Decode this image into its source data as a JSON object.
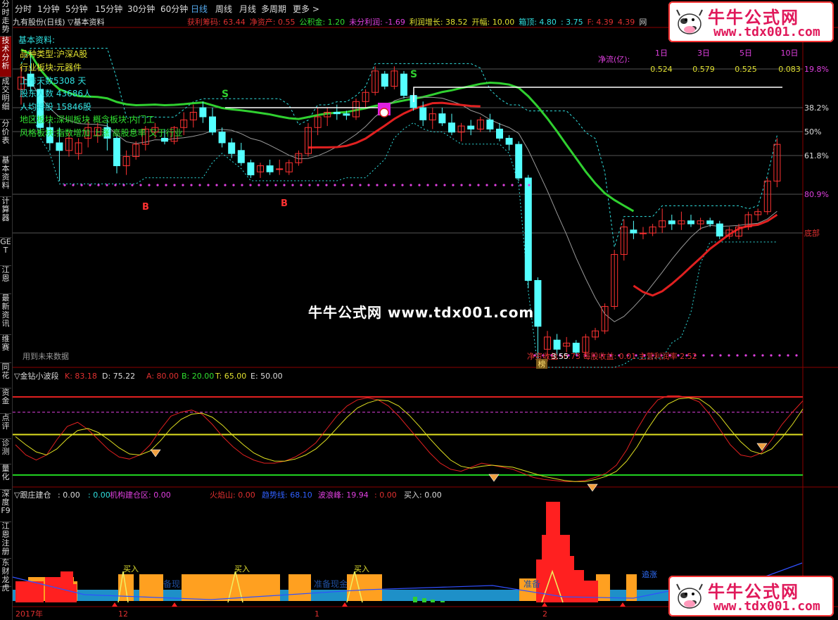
{
  "sidebar": {
    "items": [
      {
        "label": "分时走势",
        "active": false
      },
      {
        "label": "技术分析",
        "active": true
      },
      {
        "label": "成交明细",
        "active": false
      },
      {
        "label": "分价表",
        "active": false
      },
      {
        "label": "基本资料",
        "active": false
      },
      {
        "label": "计算器",
        "active": false
      },
      {
        "label": "GET",
        "active": false
      },
      {
        "label": "江恩",
        "active": false
      },
      {
        "label": "最新资讯",
        "active": false
      },
      {
        "label": "维赛",
        "active": false
      },
      {
        "label": "同花",
        "active": false
      },
      {
        "label": "资金",
        "active": false
      },
      {
        "label": "点评",
        "active": false
      },
      {
        "label": "诊测",
        "active": false
      },
      {
        "label": "量化",
        "active": false
      },
      {
        "label": "深度F9",
        "active": false
      },
      {
        "label": "江恩注册",
        "active": false
      },
      {
        "label": "东财龙虎",
        "active": false
      }
    ]
  },
  "toolbar": {
    "periods": [
      "分时",
      "1分钟",
      "5分钟",
      "15分钟",
      "30分钟",
      "60分钟",
      "日线",
      "周线",
      "月线",
      "多周期",
      "更多 >"
    ],
    "active": "日线"
  },
  "infobar": {
    "title": "九有股份(日线) ▽基本资料",
    "items": [
      {
        "text": "获利筹码: 63.44",
        "color": "#e03030"
      },
      {
        "text": "净资产: 0.55",
        "color": "#e03030"
      },
      {
        "text": "公积金: 1.20",
        "color": "#30e030"
      },
      {
        "text": "未分利润: -1.69",
        "color": "#e040e0"
      },
      {
        "text": "利润增长: 38.52",
        "color": "#e0e030"
      },
      {
        "text": "开幅: 10.00",
        "color": "#e0e030"
      },
      {
        "text": "箱顶: 4.80",
        "color": "#30e0e0"
      },
      {
        "text": ": 3.75",
        "color": "#30e0e0"
      },
      {
        "text": "F: 4.39",
        "color": "#e03030"
      },
      {
        "text": "4.39",
        "color": "#e03030"
      },
      {
        "text": "网",
        "color": "#ccc"
      }
    ]
  },
  "basic_info": [
    {
      "text": "基本资料:",
      "color": "#30e0e0"
    },
    {
      "text": "品种类型:沪深A股",
      "color": "#e0e030"
    },
    {
      "text": "行业板块:元器件",
      "color": "#e0e030"
    },
    {
      "text": "上市天数5308 天",
      "color": "#30e0e0"
    },
    {
      "text": "股东人数 43686人",
      "color": "#30e0e0"
    },
    {
      "text": "人均持股 15846股",
      "color": "#30e0e0"
    },
    {
      "text": "地区板块:深圳板块 概念板块:内门工",
      "color": "#30e030"
    },
    {
      "text": "风格板块:指数增加 上涨 高股息率 又于行业",
      "color": "#30e030"
    }
  ],
  "netflow": {
    "label": "净流(亿):",
    "headers": [
      "1日",
      "3日",
      "5日",
      "10日"
    ],
    "values": [
      "0.524",
      "0.579",
      "0.525",
      "0.083"
    ]
  },
  "fib_labels": [
    {
      "text": "19.8%",
      "color": "#e040e0"
    },
    {
      "text": "38.2%",
      "color": "#ddd"
    },
    {
      "text": "50%",
      "color": "#ddd"
    },
    {
      "text": "61.8%",
      "color": "#ddd"
    },
    {
      "text": "80.9%",
      "color": "#e040e0"
    },
    {
      "text": "底部",
      "color": "#e03030"
    }
  ],
  "signals": {
    "sell": "S",
    "buy": "B",
    "bang": "榜"
  },
  "footer_main": {
    "future": "用到未来数据",
    "price": "3.55",
    "bottom_text": "净资收益 -0.73 每股收益: 0.01 主营利润率 2.52"
  },
  "watermark": "牛牛公式网 www.tdx001.com",
  "logo": {
    "title": "牛牛公式网",
    "url": "www.tdx001.com"
  },
  "panel2": {
    "title": "▽金钻小波段",
    "items": [
      {
        "text": "K: 83.18",
        "color": "#e03030"
      },
      {
        "text": "D: 75.22",
        "color": "#ddd"
      },
      {
        "text": "A: 80.00",
        "color": "#e03030"
      },
      {
        "text": "B: 20.00",
        "color": "#30e030"
      },
      {
        "text": "T: 65.00",
        "color": "#e0e030"
      },
      {
        "text": "E: 50.00",
        "color": "#ddd"
      }
    ]
  },
  "panel3": {
    "title": "▽跟庄建仓",
    "items": [
      {
        "text": ": 0.00",
        "color": "#ddd"
      },
      {
        "text": ": 0.00",
        "color": "#30e0e0"
      },
      {
        "text": "机构建仓区: 0.00",
        "color": "#e040e0"
      },
      {
        "text": "火焰山: 0.00",
        "color": "#e03030"
      },
      {
        "text": "趋势线: 68.10",
        "color": "#3060ff"
      },
      {
        "text": "波浪峰: 19.94",
        "color": "#e040e0"
      },
      {
        "text": ": 0.00",
        "color": "#e03030"
      },
      {
        "text": "买入: 0.00",
        "color": "#ddd"
      }
    ],
    "labels": {
      "buy": "买入",
      "prep": "准备现金",
      "prep_short": "备现",
      "prep_zhun": "准备",
      "chase": "追涨"
    }
  },
  "x_axis": {
    "labels": [
      "2017年",
      "12",
      "1",
      "2"
    ]
  },
  "chart_data": {
    "type": "candlestick",
    "candles": [
      {
        "o": 4.3,
        "h": 4.45,
        "l": 4.2,
        "c": 4.38
      },
      {
        "o": 4.4,
        "h": 4.55,
        "l": 4.28,
        "c": 4.32
      },
      {
        "o": 4.3,
        "h": 4.35,
        "l": 4.0,
        "c": 4.05
      },
      {
        "o": 4.05,
        "h": 4.1,
        "l": 3.9,
        "c": 3.95
      },
      {
        "o": 3.95,
        "h": 4.05,
        "l": 3.7,
        "c": 3.9
      },
      {
        "o": 3.9,
        "h": 4.02,
        "l": 3.86,
        "c": 3.98
      },
      {
        "o": 3.88,
        "h": 3.98,
        "l": 3.84,
        "c": 3.95
      },
      {
        "o": 3.98,
        "h": 4.1,
        "l": 3.92,
        "c": 4.05
      },
      {
        "o": 4.0,
        "h": 4.08,
        "l": 3.95,
        "c": 4.05
      },
      {
        "o": 4.05,
        "h": 4.1,
        "l": 3.9,
        "c": 3.98
      },
      {
        "o": 3.98,
        "h": 4.0,
        "l": 3.75,
        "c": 3.8
      },
      {
        "o": 3.8,
        "h": 3.9,
        "l": 3.74,
        "c": 3.86
      },
      {
        "o": 3.86,
        "h": 3.96,
        "l": 3.84,
        "c": 3.94
      },
      {
        "o": 3.94,
        "h": 4.06,
        "l": 3.9,
        "c": 4.04
      },
      {
        "o": 4.02,
        "h": 4.08,
        "l": 3.98,
        "c": 4.05
      },
      {
        "o": 3.98,
        "h": 4.04,
        "l": 3.94,
        "c": 3.96
      },
      {
        "o": 3.96,
        "h": 4.06,
        "l": 3.94,
        "c": 4.05
      },
      {
        "o": 4.05,
        "h": 4.15,
        "l": 4.0,
        "c": 4.1
      },
      {
        "o": 4.1,
        "h": 4.2,
        "l": 4.05,
        "c": 4.15
      },
      {
        "o": 4.18,
        "h": 4.22,
        "l": 4.08,
        "c": 4.12
      },
      {
        "o": 4.12,
        "h": 4.18,
        "l": 4.0,
        "c": 4.02
      },
      {
        "o": 4.02,
        "h": 4.05,
        "l": 3.92,
        "c": 3.95
      },
      {
        "o": 3.95,
        "h": 3.98,
        "l": 3.85,
        "c": 3.88
      },
      {
        "o": 3.9,
        "h": 3.95,
        "l": 3.8,
        "c": 3.82
      },
      {
        "o": 3.82,
        "h": 3.84,
        "l": 3.72,
        "c": 3.74
      },
      {
        "o": 3.76,
        "h": 3.82,
        "l": 3.72,
        "c": 3.8
      },
      {
        "o": 3.8,
        "h": 3.84,
        "l": 3.74,
        "c": 3.76
      },
      {
        "o": 3.78,
        "h": 3.84,
        "l": 3.74,
        "c": 3.78
      },
      {
        "o": 3.76,
        "h": 3.84,
        "l": 3.74,
        "c": 3.82
      },
      {
        "o": 3.82,
        "h": 3.9,
        "l": 3.8,
        "c": 3.88
      },
      {
        "o": 3.88,
        "h": 4.08,
        "l": 3.86,
        "c": 4.05
      },
      {
        "o": 4.05,
        "h": 4.18,
        "l": 4.0,
        "c": 4.12
      },
      {
        "o": 4.12,
        "h": 4.18,
        "l": 4.06,
        "c": 4.15
      },
      {
        "o": 4.15,
        "h": 4.2,
        "l": 4.1,
        "c": 4.14
      },
      {
        "o": 4.14,
        "h": 4.16,
        "l": 4.1,
        "c": 4.13
      },
      {
        "o": 4.12,
        "h": 4.24,
        "l": 4.1,
        "c": 4.22
      },
      {
        "o": 4.22,
        "h": 4.3,
        "l": 4.18,
        "c": 4.28
      },
      {
        "o": 4.28,
        "h": 4.45,
        "l": 4.26,
        "c": 4.42
      },
      {
        "o": 4.4,
        "h": 4.42,
        "l": 4.3,
        "c": 4.32
      },
      {
        "o": 4.32,
        "h": 4.45,
        "l": 4.3,
        "c": 4.42
      },
      {
        "o": 4.4,
        "h": 4.42,
        "l": 4.24,
        "c": 4.26
      },
      {
        "o": 4.26,
        "h": 4.28,
        "l": 4.16,
        "c": 4.18
      },
      {
        "o": 4.18,
        "h": 4.22,
        "l": 4.06,
        "c": 4.1
      },
      {
        "o": 4.1,
        "h": 4.18,
        "l": 4.04,
        "c": 4.14
      },
      {
        "o": 4.14,
        "h": 4.18,
        "l": 4.06,
        "c": 4.08
      },
      {
        "o": 4.08,
        "h": 4.14,
        "l": 4.0,
        "c": 4.02
      },
      {
        "o": 4.02,
        "h": 4.08,
        "l": 3.96,
        "c": 4.06
      },
      {
        "o": 4.06,
        "h": 4.1,
        "l": 4.0,
        "c": 4.04
      },
      {
        "o": 4.04,
        "h": 4.12,
        "l": 4.02,
        "c": 4.1
      },
      {
        "o": 4.1,
        "h": 4.14,
        "l": 4.02,
        "c": 4.04
      },
      {
        "o": 4.04,
        "h": 4.08,
        "l": 3.96,
        "c": 3.98
      },
      {
        "o": 3.98,
        "h": 4.0,
        "l": 3.9,
        "c": 3.94
      },
      {
        "o": 3.94,
        "h": 3.96,
        "l": 3.7,
        "c": 3.72
      },
      {
        "o": 3.72,
        "h": 3.74,
        "l": 3.0,
        "c": 3.05
      },
      {
        "o": 3.05,
        "h": 3.07,
        "l": 2.5,
        "c": 2.75
      },
      {
        "o": 2.6,
        "h": 2.72,
        "l": 2.52,
        "c": 2.68
      },
      {
        "o": 2.66,
        "h": 2.7,
        "l": 2.56,
        "c": 2.6
      },
      {
        "o": 2.62,
        "h": 2.68,
        "l": 2.58,
        "c": 2.64
      },
      {
        "o": 2.64,
        "h": 2.66,
        "l": 2.56,
        "c": 2.58
      },
      {
        "o": 2.58,
        "h": 2.7,
        "l": 2.56,
        "c": 2.68
      },
      {
        "o": 2.68,
        "h": 2.74,
        "l": 2.66,
        "c": 2.72
      },
      {
        "o": 2.72,
        "h": 2.9,
        "l": 2.7,
        "c": 2.88
      },
      {
        "o": 2.88,
        "h": 3.25,
        "l": 2.86,
        "c": 3.22
      },
      {
        "o": 3.22,
        "h": 3.45,
        "l": 3.18,
        "c": 3.4
      },
      {
        "o": 3.38,
        "h": 3.44,
        "l": 3.32,
        "c": 3.36
      },
      {
        "o": 3.36,
        "h": 3.4,
        "l": 3.32,
        "c": 3.36
      },
      {
        "o": 3.36,
        "h": 3.42,
        "l": 3.34,
        "c": 3.4
      },
      {
        "o": 3.4,
        "h": 3.52,
        "l": 3.36,
        "c": 3.44
      },
      {
        "o": 3.44,
        "h": 3.48,
        "l": 3.38,
        "c": 3.42
      },
      {
        "o": 3.42,
        "h": 3.5,
        "l": 3.38,
        "c": 3.44
      },
      {
        "o": 3.44,
        "h": 3.48,
        "l": 3.4,
        "c": 3.42
      },
      {
        "o": 3.42,
        "h": 3.46,
        "l": 3.38,
        "c": 3.44
      },
      {
        "o": 3.44,
        "h": 3.46,
        "l": 3.4,
        "c": 3.42
      },
      {
        "o": 3.42,
        "h": 3.44,
        "l": 3.32,
        "c": 3.34
      },
      {
        "o": 3.34,
        "h": 3.4,
        "l": 3.32,
        "c": 3.38
      },
      {
        "o": 3.34,
        "h": 3.42,
        "l": 3.32,
        "c": 3.4
      },
      {
        "o": 3.4,
        "h": 3.5,
        "l": 3.38,
        "c": 3.48
      },
      {
        "o": 3.48,
        "h": 3.52,
        "l": 3.44,
        "c": 3.5
      },
      {
        "o": 3.5,
        "h": 3.72,
        "l": 3.48,
        "c": 3.7
      },
      {
        "o": 3.7,
        "h": 3.98,
        "l": 3.66,
        "c": 3.94
      }
    ],
    "kd": {
      "k": [
        40,
        30,
        25,
        30,
        45,
        58,
        62,
        55,
        45,
        35,
        28,
        26,
        30,
        40,
        55,
        68,
        72,
        74,
        70,
        60,
        48,
        38,
        30,
        25,
        22,
        22,
        24,
        28,
        34,
        42,
        55,
        68,
        78,
        84,
        86,
        84,
        78,
        68,
        56,
        44,
        32,
        22,
        16,
        14,
        18,
        22,
        20,
        18,
        16,
        12,
        8,
        6,
        5,
        4,
        4,
        5,
        8,
        12,
        20,
        35,
        55,
        72,
        84,
        88,
        88,
        86,
        82,
        70,
        55,
        40,
        30,
        28,
        32,
        45,
        60,
        72,
        83
      ],
      "d": [
        48,
        40,
        33,
        30,
        36,
        46,
        54,
        56,
        52,
        45,
        37,
        31,
        30,
        34,
        44,
        56,
        65,
        70,
        71,
        67,
        59,
        49,
        40,
        32,
        27,
        24,
        24,
        26,
        30,
        36,
        45,
        56,
        67,
        76,
        81,
        84,
        83,
        78,
        69,
        58,
        46,
        35,
        25,
        19,
        17,
        19,
        20,
        19,
        18,
        15,
        12,
        9,
        7,
        5,
        4,
        4,
        6,
        9,
        14,
        24,
        38,
        55,
        70,
        80,
        85,
        86,
        85,
        78,
        68,
        55,
        43,
        34,
        31,
        36,
        47,
        60,
        75
      ]
    },
    "lines": {
      "A": 80,
      "B": 20,
      "T": 65,
      "E": 50
    },
    "y_ranges": {
      "main": [
        2.5,
        4.7
      ],
      "kd": [
        0,
        100
      ]
    }
  },
  "colors": {
    "up": "#ff3232",
    "down": "#54ffff",
    "ma_green": "#30d030",
    "ma_red": "#e02020",
    "ma_gray": "#999999",
    "magenta": "#e040e0",
    "cyan": "#30e0e0",
    "yellow": "#e0e030"
  }
}
